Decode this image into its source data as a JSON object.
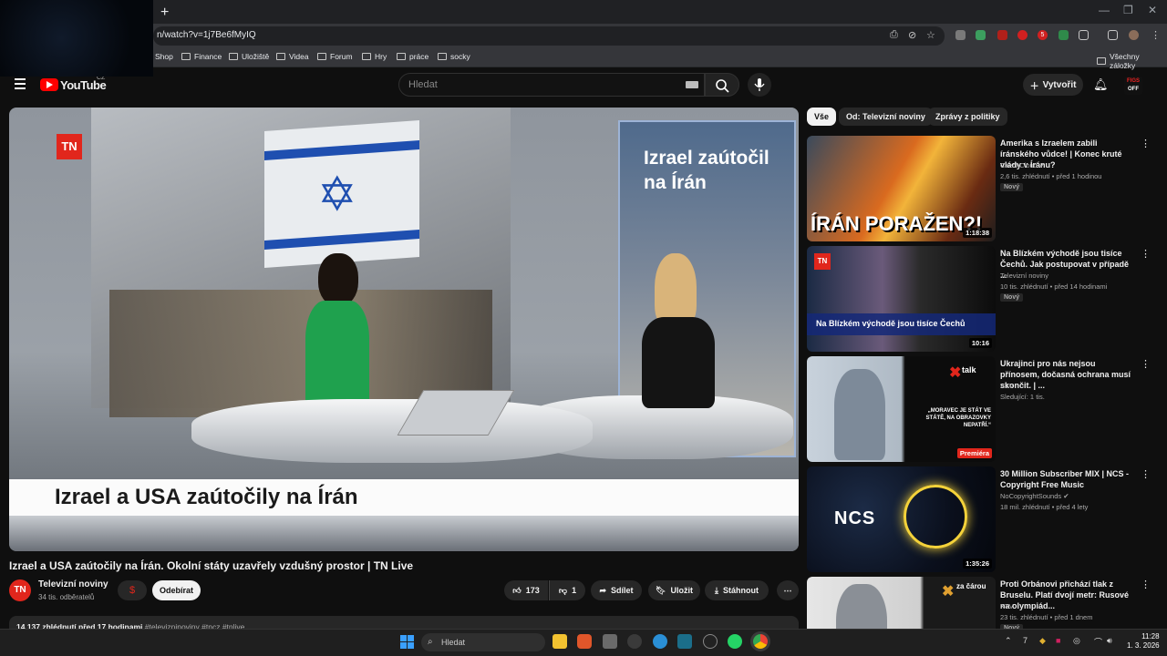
{
  "browser": {
    "new_tab_label": "+",
    "url": "n/watch?v=1j7Be6fMyIQ",
    "bookmarks": [
      "Shop",
      "Finance",
      "Uložiště",
      "Videa",
      "Forum",
      "Hry",
      "práce",
      "socky"
    ],
    "all_bookmarks_label": "Všechny záložky",
    "extension_badge": "5"
  },
  "youtube": {
    "logo_text": "YouTube",
    "country_code": "CZ",
    "search_placeholder": "Hledat",
    "create_label": "Vytvořit",
    "avatar_line1": "FIGS",
    "avatar_line2": "OFF"
  },
  "video": {
    "channel_logo": "TN",
    "screen_text": "Izrael zaútočil na Írán",
    "lower_third": "Izrael a USA zaútočily na Írán"
  },
  "watch": {
    "title": "Izrael a USA zaútočily na Írán. Okolní státy uzavřely vzdušný prostor | TN Live",
    "channel_initials": "TN",
    "channel_name": "Televizní noviny",
    "subscribers": "34 tis. odběratelů",
    "join_symbol": "$",
    "subscribe_label": "Odebírat",
    "likes": "173",
    "dislikes": "1",
    "share_label": "Sdílet",
    "save_label": "Uložit",
    "download_label": "Stáhnout",
    "views_time": "14 137 zhlédnutí  před 17 hodinami",
    "hashtags": "#televizninoviny #tncz #tnlive"
  },
  "filters": [
    "Vše",
    "Od: Televizní noviny",
    "Zprávy z politiky"
  ],
  "recommendations": [
    {
      "title": "Amerika s Izraelem zabili íránského vůdce! | Konec kruté vlády v Íránu?",
      "channel": "CzechCloud ✔",
      "meta": "2,6 tis. zhlédnutí • před 1 hodinou",
      "badge": "Nový",
      "duration": "1:18:38",
      "overlay": "ÍRÁN PORAŽEN?!"
    },
    {
      "title": "Na Blízkém východě jsou tisíce Čechů. Jak postupovat v případě ...",
      "channel": "Televizní noviny",
      "meta": "10 tis. zhlédnutí • před 14 hodinami",
      "badge": "Nový",
      "duration": "10:16",
      "overlay": "Na Blízkém východě jsou tisíce Čechů"
    },
    {
      "title": "Ukrajinci pro nás nejsou přínosem, dočasná ochrana musí skončit. | ...",
      "channel": "XTV",
      "meta": "Sledující: 1 tis.",
      "badge": "",
      "duration": "Premiéra",
      "overlay": "„MORAVEC JE STÁT VE STÁTĚ, NA OBRAZOVKY NEPATŘÍ.“"
    },
    {
      "title": "30 Million Subscriber MIX | NCS - Copyright Free Music",
      "channel": "NoCopyrightSounds ✔",
      "meta": "18 mil. zhlédnutí • před 4 lety",
      "badge": "",
      "duration": "1:35:26",
      "overlay": "NCS"
    },
    {
      "title": "Proti Orbánovi přichází tlak z Bruselu. Platí dvojí metr: Rusové na olympiád...",
      "channel": "XTV",
      "meta": "23 tis. zhlédnutí • před 1 dnem",
      "badge": "Nový",
      "duration": "",
      "overlay": "za čárou"
    }
  ],
  "taskbar": {
    "search_label": "Hledat",
    "time": "11:28",
    "date": "1. 3. 2026"
  },
  "colors": {
    "youtube_red": "#ff0000",
    "tn_red": "#e1261c",
    "background": "#0f0f0f"
  }
}
